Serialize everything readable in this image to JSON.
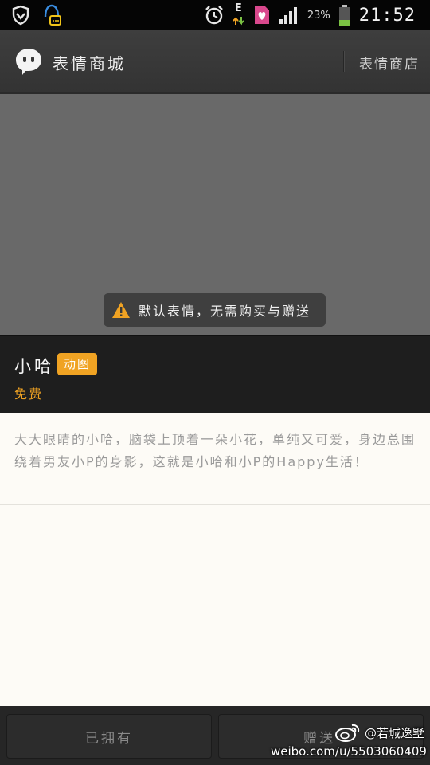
{
  "status_bar": {
    "time": "21:52",
    "battery_percent": "23%",
    "network_type": "E",
    "icons": [
      "vpn-shield-icon",
      "notification-app-icon",
      "alarm-icon",
      "data-transfer-icon",
      "sim-card-icon",
      "signal-icon",
      "battery-icon"
    ]
  },
  "header": {
    "title": "表情商城",
    "shop_link": "表情商店",
    "icon": "chat-bubble-icon"
  },
  "preview": {
    "notice": "默认表情，无需购买与赠送",
    "notice_icon": "warning-icon"
  },
  "pack": {
    "name": "小哈",
    "badge": "动图",
    "price": "免费"
  },
  "description": "大大眼睛的小哈，脑袋上顶着一朵小花，单纯又可爱，身边总围绕着男友小P的身影，这就是小哈和小P的Happy生活！",
  "actions": {
    "owned": "已拥有",
    "gift": "赠送"
  },
  "watermark": {
    "handle": "@若城逸墅",
    "url": "weibo.com/u/5503060409",
    "icon": "weibo-icon"
  },
  "colors": {
    "accent": "#f0a323",
    "title_bar": "#3a3a3a",
    "preview_bg": "#696969"
  }
}
